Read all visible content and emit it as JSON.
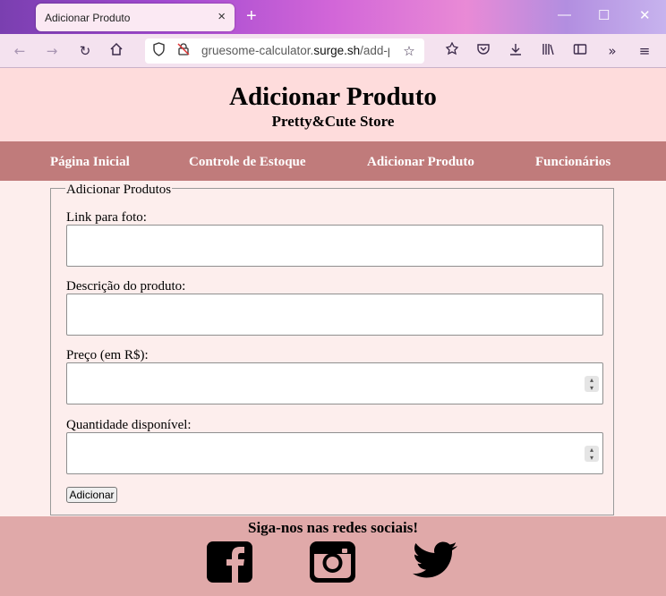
{
  "browser": {
    "tab_title": "Adicionar Produto",
    "tab_close": "×",
    "new_tab": "+",
    "url_pre": "gruesome-calculator.",
    "url_domain": "surge.sh",
    "url_post": "/add-p",
    "win_min": "—",
    "win_max": "☐",
    "win_close": "✕"
  },
  "header": {
    "title": "Adicionar Produto",
    "subtitle": "Pretty&Cute Store"
  },
  "menu": [
    {
      "label": "Página Inicial"
    },
    {
      "label": "Controle de Estoque"
    },
    {
      "label": "Adicionar Produto"
    },
    {
      "label": "Funcionários"
    }
  ],
  "form": {
    "legend": "Adicionar Produtos",
    "fields": [
      {
        "label": "Link para foto:",
        "value": ""
      },
      {
        "label": "Descrição do produto:",
        "value": ""
      },
      {
        "label": "Preço (em R$):",
        "value": ""
      },
      {
        "label": "Quantidade disponível:",
        "value": ""
      }
    ],
    "submit_label": "Adicionar"
  },
  "footer": {
    "follow_text": "Siga-nos nas redes sociais!",
    "social_icons": [
      "facebook-icon",
      "instagram-icon",
      "twitter-icon"
    ]
  },
  "colors": {
    "header_bg": "#fedcdc",
    "menu_bg": "#c07b7b",
    "page_bg": "#fdeeed",
    "footer_bg": "#e0a9a9"
  }
}
